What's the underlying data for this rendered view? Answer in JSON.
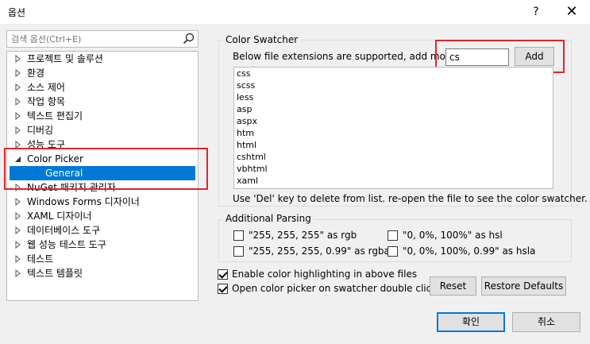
{
  "window": {
    "title": "옵션",
    "help": "?",
    "close": "✕"
  },
  "search": {
    "placeholder": "검색 옵션(Ctrl+E)"
  },
  "tree": {
    "items": [
      {
        "label": "프로젝트 및 솔루션"
      },
      {
        "label": "환경"
      },
      {
        "label": "소스 제어"
      },
      {
        "label": "작업 항목"
      },
      {
        "label": "텍스트 편집기"
      },
      {
        "label": "디버깅"
      },
      {
        "label": "성능 도구"
      },
      {
        "label": "Color Picker"
      },
      {
        "label": "General"
      },
      {
        "label": "NuGet 패키지 관리자"
      },
      {
        "label": "Windows Forms 디자이너"
      },
      {
        "label": "XAML 디자이너"
      },
      {
        "label": "데이터베이스 도구"
      },
      {
        "label": "웹 성능 테스트 도구"
      },
      {
        "label": "테스트"
      },
      {
        "label": "텍스트 템플릿"
      }
    ]
  },
  "swatcher": {
    "group_title": "Color Swatcher",
    "description": "Below file extensions are supported, add more",
    "input_value": "cs",
    "add_label": "Add",
    "extensions": [
      "css",
      "scss",
      "less",
      "asp",
      "aspx",
      "htm",
      "html",
      "cshtml",
      "vbhtml",
      "xaml"
    ],
    "hint": "Use 'Del' key to delete from list. re-open the file to see the color swatcher."
  },
  "parsing": {
    "group_title": "Additional Parsing",
    "options": [
      {
        "label": "\"255, 255, 255\" as rgb",
        "checked": false
      },
      {
        "label": "\"0, 0%, 100%\" as hsl",
        "checked": false
      },
      {
        "label": "\"255, 255, 255, 0.99\" as rgba",
        "checked": false
      },
      {
        "label": "\"0, 0%, 100%, 0.99\" as hsla",
        "checked": false
      }
    ]
  },
  "settings": {
    "highlight_label": "Enable color highlighting in above files",
    "highlight_checked": true,
    "doubleclick_label": "Open color picker on swatcher double click",
    "doubleclick_checked": true,
    "reset_label": "Reset",
    "restore_label": "Restore Defaults"
  },
  "footer": {
    "ok_label": "확인",
    "cancel_label": "취소"
  },
  "colors": {
    "selection": "#0078d7",
    "annotation": "#e0252b"
  }
}
